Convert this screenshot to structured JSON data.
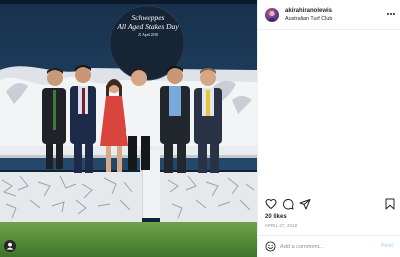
{
  "photo": {
    "sign": {
      "sponsor": "Schweppes",
      "event": "All Aged Stakes Day",
      "date": "21 April 2018"
    }
  },
  "post": {
    "username": "akirahiranolewis",
    "location": "Australian Turf Club",
    "likes": "20 likes",
    "date": "APRIL 27, 2018"
  },
  "actions": [
    "heart-icon",
    "comment-icon",
    "share-icon",
    "bookmark-icon"
  ],
  "comment": {
    "placeholder": "Add a comment...",
    "post_label": "Post"
  },
  "colors": {
    "text": "#262626",
    "secondary_text": "#8e8e8e",
    "post_button_disabled": "#b2dffc",
    "divider": "#efefef"
  }
}
